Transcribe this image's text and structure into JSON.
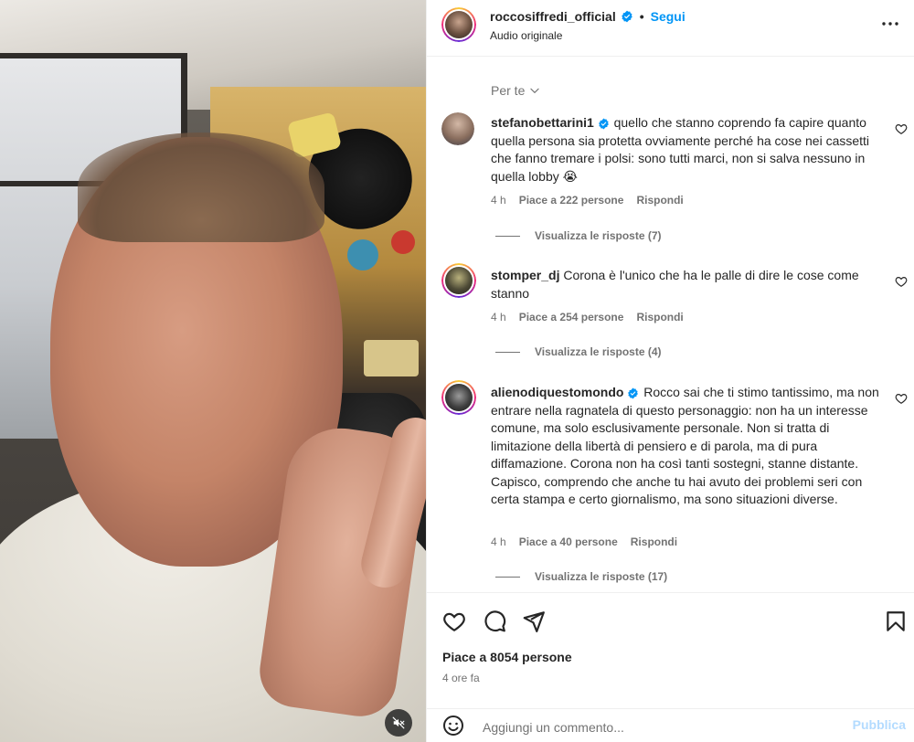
{
  "colors": {
    "accent": "#0095f6",
    "text": "#262626",
    "muted": "#737373",
    "publish_disabled": "#b3dbff",
    "verified": "#0095f6"
  },
  "header": {
    "username": "roccosiffredi_official",
    "verified": true,
    "separator": "•",
    "follow_label": "Segui",
    "subtitle": "Audio originale",
    "more_icon": "more-horizontal-icon"
  },
  "media": {
    "mute_icon": "speaker-muted-icon"
  },
  "comments_section": {
    "sort_label": "Per te",
    "comments": [
      {
        "username": "stefanobettarini1",
        "verified": true,
        "text": "quello che stanno coprendo fa capire quanto quella persona sia protetta ovviamente perché ha cose nei cassetti che fanno tremare i polsi: sono tutti marci, non si salva nessuno in quella lobby 😭",
        "time": "4 h",
        "likes": "Piace a 222 persone",
        "reply_label": "Rispondi",
        "view_replies": "Visualizza le risposte (7)"
      },
      {
        "username": "stomper_dj",
        "verified": false,
        "text": "Corona è l'unico che ha le palle di dire le cose come stanno",
        "time": "4 h",
        "likes": "Piace a 254 persone",
        "reply_label": "Rispondi",
        "view_replies": "Visualizza le risposte (4)"
      },
      {
        "username": "alienodiquestomondo",
        "verified": true,
        "text": "Rocco sai che ti stimo tantissimo, ma non entrare nella ragnatela di questo personaggio: non ha un interesse comune, ma solo esclusivamente personale. Non si tratta di limitazione della libertà di pensiero e di parola, ma di pura diffamazione. Corona non ha così tanti sostegni, stanne distante. Capisco, comprendo che anche tu hai avuto dei problemi seri con certa stampa e certo giornalismo, ma sono situazioni diverse.",
        "time": "4 h",
        "likes": "Piace a 40 persone",
        "reply_label": "Rispondi",
        "view_replies": "Visualizza le risposte (17)"
      }
    ]
  },
  "actions": {
    "like_icon": "heart-icon",
    "comment_icon": "comment-icon",
    "share_icon": "share-icon",
    "save_icon": "bookmark-icon",
    "likes_text": "Piace a 8054 persone",
    "time_text": "4 ore fa"
  },
  "add_comment": {
    "placeholder": "Aggiungi un commento...",
    "publish_label": "Pubblica",
    "emoji_icon": "emoji-icon"
  }
}
